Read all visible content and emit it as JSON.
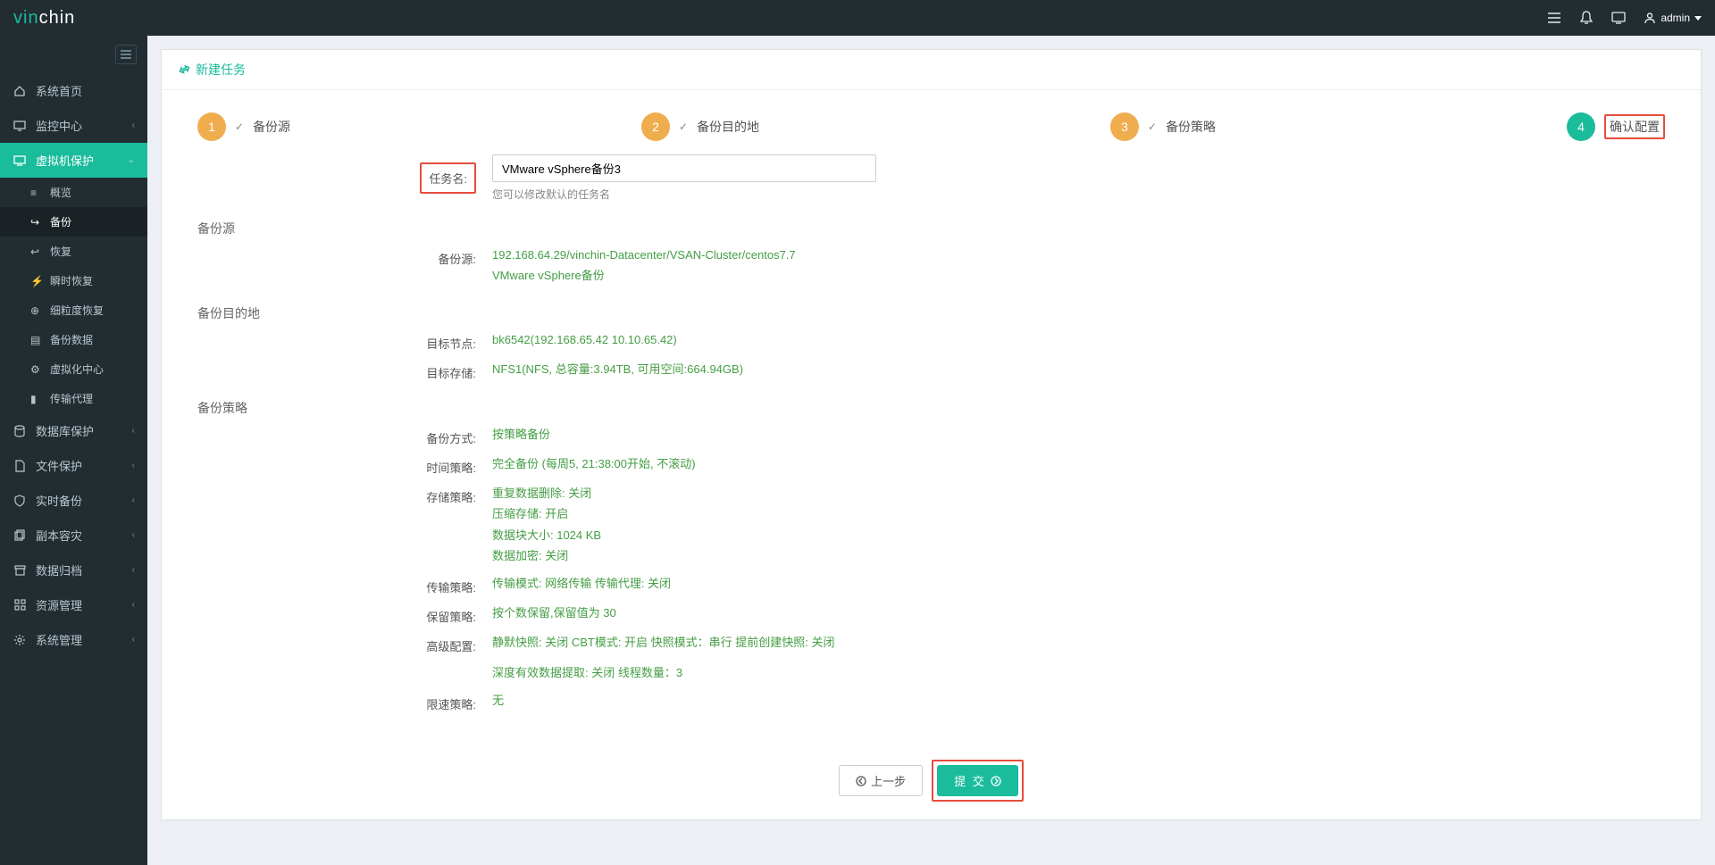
{
  "header": {
    "logo_text": "vinchin",
    "user_name": "admin"
  },
  "sidebar": {
    "items": [
      {
        "label": "系统首页",
        "icon": "home"
      },
      {
        "label": "监控中心",
        "icon": "monitor",
        "expandable": true
      },
      {
        "label": "虚拟机保护",
        "icon": "vm",
        "expandable": true,
        "active": true
      },
      {
        "label": "数据库保护",
        "icon": "db",
        "expandable": true
      },
      {
        "label": "文件保护",
        "icon": "file",
        "expandable": true
      },
      {
        "label": "实时备份",
        "icon": "shield",
        "expandable": true
      },
      {
        "label": "副本容灾",
        "icon": "copy",
        "expandable": true
      },
      {
        "label": "数据归档",
        "icon": "archive",
        "expandable": true
      },
      {
        "label": "资源管理",
        "icon": "resource",
        "expandable": true
      },
      {
        "label": "系统管理",
        "icon": "gear",
        "expandable": true
      }
    ],
    "vm_sub": [
      {
        "label": "概览"
      },
      {
        "label": "备份",
        "current": true
      },
      {
        "label": "恢复"
      },
      {
        "label": "瞬时恢复"
      },
      {
        "label": "细粒度恢复"
      },
      {
        "label": "备份数据"
      },
      {
        "label": "虚拟化中心"
      },
      {
        "label": "传输代理"
      }
    ]
  },
  "page": {
    "title": "新建任务",
    "steps": [
      {
        "num": "1",
        "label": "备份源",
        "done": true
      },
      {
        "num": "2",
        "label": "备份目的地",
        "done": true
      },
      {
        "num": "3",
        "label": "备份策略",
        "done": true
      },
      {
        "num": "4",
        "label": "确认配置",
        "current": true
      }
    ],
    "task_name_label": "任务名:",
    "task_name_value": "VMware vSphere备份3",
    "task_name_hint": "您可以修改默认的任务名",
    "sections": {
      "source_title": "备份源",
      "source_label": "备份源:",
      "source_line1": "192.168.64.29/vinchin-Datacenter/VSAN-Cluster/centos7.7",
      "source_line2": "VMware vSphere备份",
      "dest_title": "备份目的地",
      "dest_node_label": "目标节点:",
      "dest_node_value": "bk6542(192.168.65.42 10.10.65.42)",
      "dest_storage_label": "目标存储:",
      "dest_storage_value": "NFS1(NFS, 总容量:3.94TB, 可用空间:664.94GB)",
      "policy_title": "备份策略",
      "mode_label": "备份方式:",
      "mode_value": "按策略备份",
      "time_label": "时间策略:",
      "time_value": "完全备份 (每周5, 21:38:00开始, 不滚动)",
      "storage_label": "存储策略:",
      "storage_line1": "重复数据删除: 关闭",
      "storage_line2": "压缩存储: 开启",
      "storage_line3": "数据块大小: 1024 KB",
      "storage_line4": "数据加密: 关闭",
      "transfer_label": "传输策略:",
      "transfer_value": "传输模式: 网络传输 传输代理: 关闭",
      "retain_label": "保留策略:",
      "retain_value": "按个数保留,保留值为 30",
      "advanced_label": "高级配置:",
      "advanced_line1": "静默快照: 关闭 CBT模式: 开启 快照模式：串行 提前创建快照: 关闭",
      "advanced_line2": "深度有效数据提取: 关闭 线程数量：3",
      "limit_label": "限速策略:",
      "limit_value": "无"
    },
    "buttons": {
      "prev": "上一步",
      "submit": "提 交"
    }
  }
}
